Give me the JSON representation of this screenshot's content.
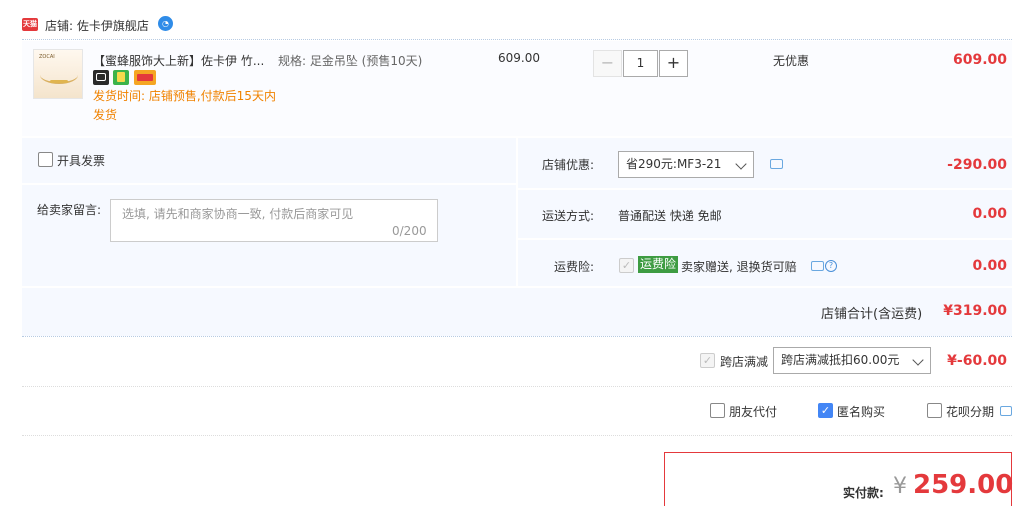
{
  "shop": {
    "badge": "天猫",
    "label": "店铺: 佐卡伊旗舰店",
    "wangwang_icon": "chat-bubble-icon"
  },
  "item": {
    "title": "【蜜蜂服饰大上新】佐卡伊 竹...",
    "spec": "规格: 足金吊坠 (预售10天)",
    "unit_price": "609.00",
    "quantity": "1",
    "minus": "−",
    "plus": "+",
    "discount": "无优惠",
    "total": "609.00",
    "thumb_brand": "ZOCAI",
    "service_icons": [
      {
        "name": "tmall-cat-icon",
        "color": "#2a2a2a"
      },
      {
        "name": "guarantee-icon",
        "color": "#3cb34a"
      },
      {
        "name": "card-pay-icon",
        "color": "#f5a623"
      }
    ],
    "ship_note": "发货时间: 店铺预售,付款后15天内发货"
  },
  "invoice": {
    "label": "开具发票"
  },
  "message": {
    "label": "给卖家留言:",
    "placeholder": "选填, 请先和商家协商一致, 付款后商家可见",
    "count": "0/200"
  },
  "shop_discount": {
    "label": "店铺优惠:",
    "selected": "省290元:MF3-21",
    "amount": "-290.00"
  },
  "shipping": {
    "label": "运送方式:",
    "value": "普通配送 快递 免邮",
    "amount": "0.00"
  },
  "insurance": {
    "label": "运费险:",
    "tag": "运费险",
    "text": "卖家赠送, 退换货可赔",
    "amount": "0.00"
  },
  "shop_total": {
    "label": "店铺合计(含运费)",
    "amount": "¥319.00"
  },
  "cross_store": {
    "label": "跨店满减",
    "selected": "跨店满减抵扣60.00元",
    "amount": "¥-60.00"
  },
  "options": {
    "friend_pay": "朋友代付",
    "anonymous": "匿名购买",
    "huabei": "花呗分期"
  },
  "payment": {
    "label": "实付款:",
    "currency": "¥",
    "amount": "259.00"
  },
  "colors": {
    "accent_red": "#e4393c",
    "accent_blue": "#4386f5",
    "ship_orange": "#f08200"
  }
}
